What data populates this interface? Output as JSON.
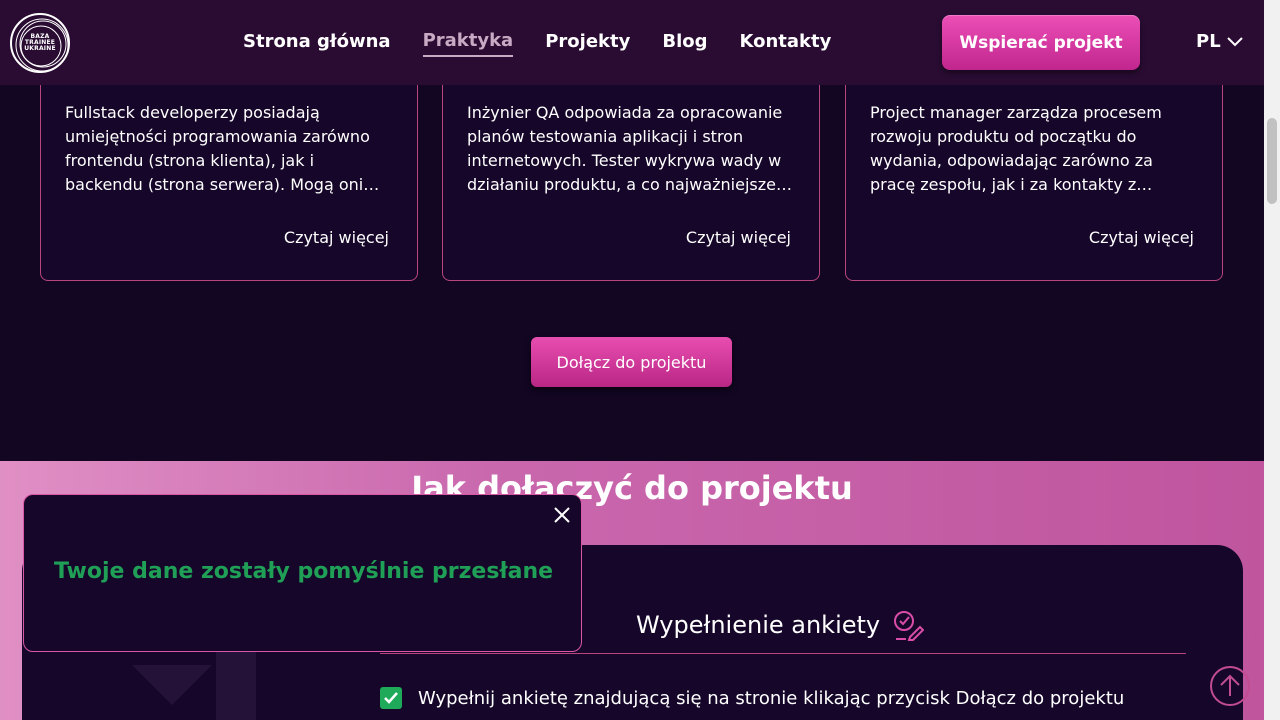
{
  "header": {
    "logo_lines": [
      "BAZA",
      "TRAINEE",
      "UKRAINE"
    ],
    "nav": [
      {
        "label": "Strona główna",
        "active": false
      },
      {
        "label": "Praktyka",
        "active": true
      },
      {
        "label": "Projekty",
        "active": false
      },
      {
        "label": "Blog",
        "active": false
      },
      {
        "label": "Kontakty",
        "active": false
      }
    ],
    "support_button": "Wspierać projekt",
    "language": "PL"
  },
  "cards": [
    {
      "text": "Fullstack developerzy posiadają umiejętności programowania zarówno frontendu (strona klienta), jak i backendu (strona serwera). Mogą oni…",
      "link": "Czytaj więcej"
    },
    {
      "text": "Inżynier QA odpowiada za opracowanie planów testowania aplikacji i stron internetowych. Tester wykrywa wady w działaniu produktu, a co najważniejsze …",
      "link": "Czytaj więcej"
    },
    {
      "text": "Project manager zarządza procesem rozwoju produktu od początku do wydania, odpowiadając zarówno za pracę zespołu, jak i za kontakty z…",
      "link": "Czytaj więcej"
    }
  ],
  "join_button": "Dołącz do projektu",
  "how_to_join": {
    "title": "Jak dołączyć do projektu",
    "heading": "Wypełnienie ankiety",
    "steps": [
      {
        "text": "Wypełnij ankietę znajdującą się na stronie klikając przycisk Dołącz do projektu",
        "checked": true
      }
    ]
  },
  "toast": {
    "message": "Twoje dane zostały pomyślnie przesłane"
  },
  "colors": {
    "accent": "#d94ca8",
    "background": "#120622",
    "header": "#2a0c33",
    "success": "#1fa056"
  }
}
